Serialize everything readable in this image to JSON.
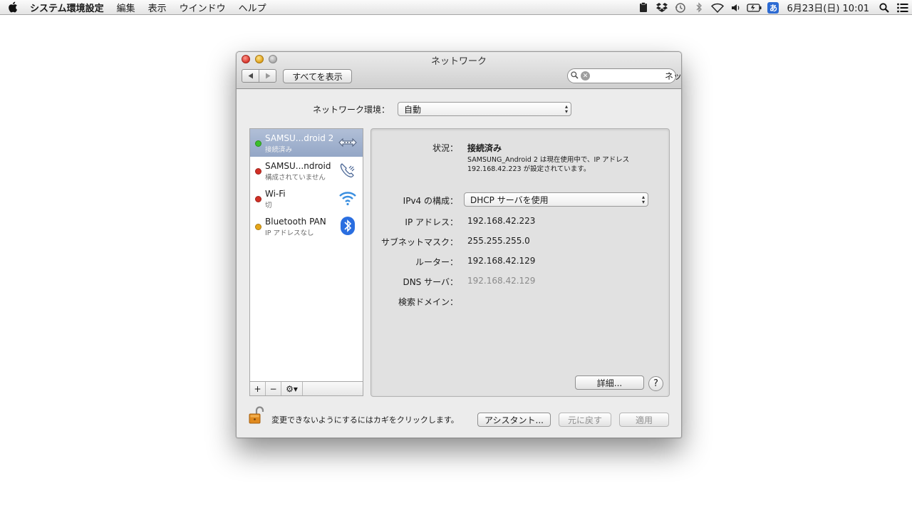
{
  "menubar": {
    "app_name": "システム環境設定",
    "items": [
      "編集",
      "表示",
      "ウインドウ",
      "ヘルプ"
    ],
    "ime_label": "あ",
    "clock": "6月23日(日)  10:01",
    "status_icons": [
      "clipboard-icon",
      "dropbox-icon",
      "time-machine-icon",
      "bluetooth-icon",
      "wifi-icon",
      "volume-icon",
      "battery-icon",
      "input-method-icon",
      "spotlight-icon",
      "notification-center-icon"
    ]
  },
  "window": {
    "title": "ネットワーク",
    "show_all_label": "すべてを表示",
    "search_value": "ネットワーク",
    "location_label": "ネットワーク環境：",
    "location_value": "自動"
  },
  "services": [
    {
      "name": "SAMSU...droid 2",
      "status": "接続済み",
      "status_color": "#3bbf2a",
      "icon": "ethernet-arrows-icon",
      "selected": true
    },
    {
      "name": "SAMSU...ndroid",
      "status": "構成されていません",
      "status_color": "#d22f25",
      "icon": "phone-modem-icon",
      "selected": false
    },
    {
      "name": "Wi-Fi",
      "status": "切",
      "status_color": "#d22f25",
      "icon": "wifi-icon",
      "selected": false
    },
    {
      "name": "Bluetooth PAN",
      "status": "IP アドレスなし",
      "status_color": "#e6a619",
      "icon": "bluetooth-icon",
      "selected": false
    }
  ],
  "list_toolbar": {
    "add": "+",
    "remove": "−",
    "action": "⚙▾"
  },
  "detail": {
    "status_label": "状況：",
    "status_value": "接続済み",
    "status_desc_line1": "SAMSUNG_Android 2 は現在使用中で、IP アドレス",
    "status_desc_line2": "192.168.42.223 が設定されています。",
    "ipv4_label": "IPv4 の構成：",
    "ipv4_value": "DHCP サーバを使用",
    "ip_label": "IP アドレス：",
    "ip_value": "192.168.42.223",
    "subnet_label": "サブネットマスク：",
    "subnet_value": "255.255.255.0",
    "router_label": "ルーター：",
    "router_value": "192.168.42.129",
    "dns_label": "DNS サーバ：",
    "dns_value": "192.168.42.129",
    "search_domain_label": "検索ドメイン：",
    "advanced_label": "詳細...",
    "help_label": "?"
  },
  "footer": {
    "lock_text": "変更できないようにするにはカギをクリックします。",
    "assistant_label": "アシスタント...",
    "revert_label": "元に戻す",
    "apply_label": "適用"
  }
}
